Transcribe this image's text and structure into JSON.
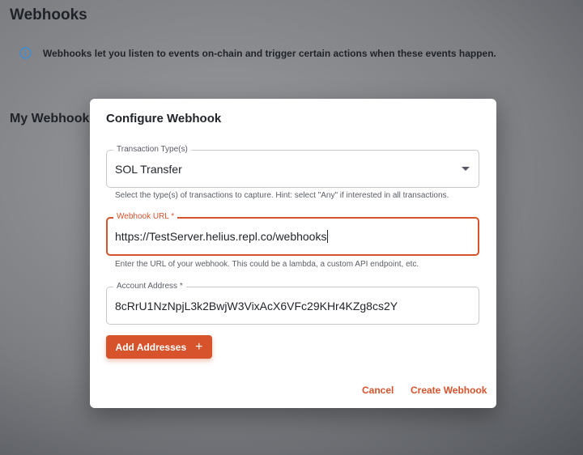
{
  "page": {
    "title": "Webhooks",
    "info_text": "Webhooks let you listen to events on-chain and trigger certain actions when these events happen.",
    "section_title": "My Webhooks"
  },
  "modal": {
    "title": "Configure Webhook",
    "transaction_type": {
      "label": "Transaction Type(s)",
      "value": "SOL Transfer",
      "helper": "Select the type(s) of transactions to capture. Hint: select \"Any\" if interested in all transactions."
    },
    "webhook_url": {
      "label": "Webhook URL *",
      "value": "https://TestServer.helius.repl.co/webhooks",
      "helper": "Enter the URL of your webhook. This could be a lambda, a custom API endpoint, etc."
    },
    "account_address": {
      "label": "Account Address *",
      "value": "8cRrU1NzNpjL3k2BwjW3VixAcX6VFc29KHr4KZg8cs2Y"
    },
    "add_addresses_label": "Add Addresses",
    "add_icon": "+",
    "cancel_label": "Cancel",
    "create_label": "Create Webhook"
  },
  "colors": {
    "accent": "#d6532c",
    "info": "#3b8fd6",
    "text": "#1f2329"
  },
  "icons": {
    "info": "info-circle-icon",
    "dropdown": "caret-down-icon",
    "add": "plus-icon"
  }
}
